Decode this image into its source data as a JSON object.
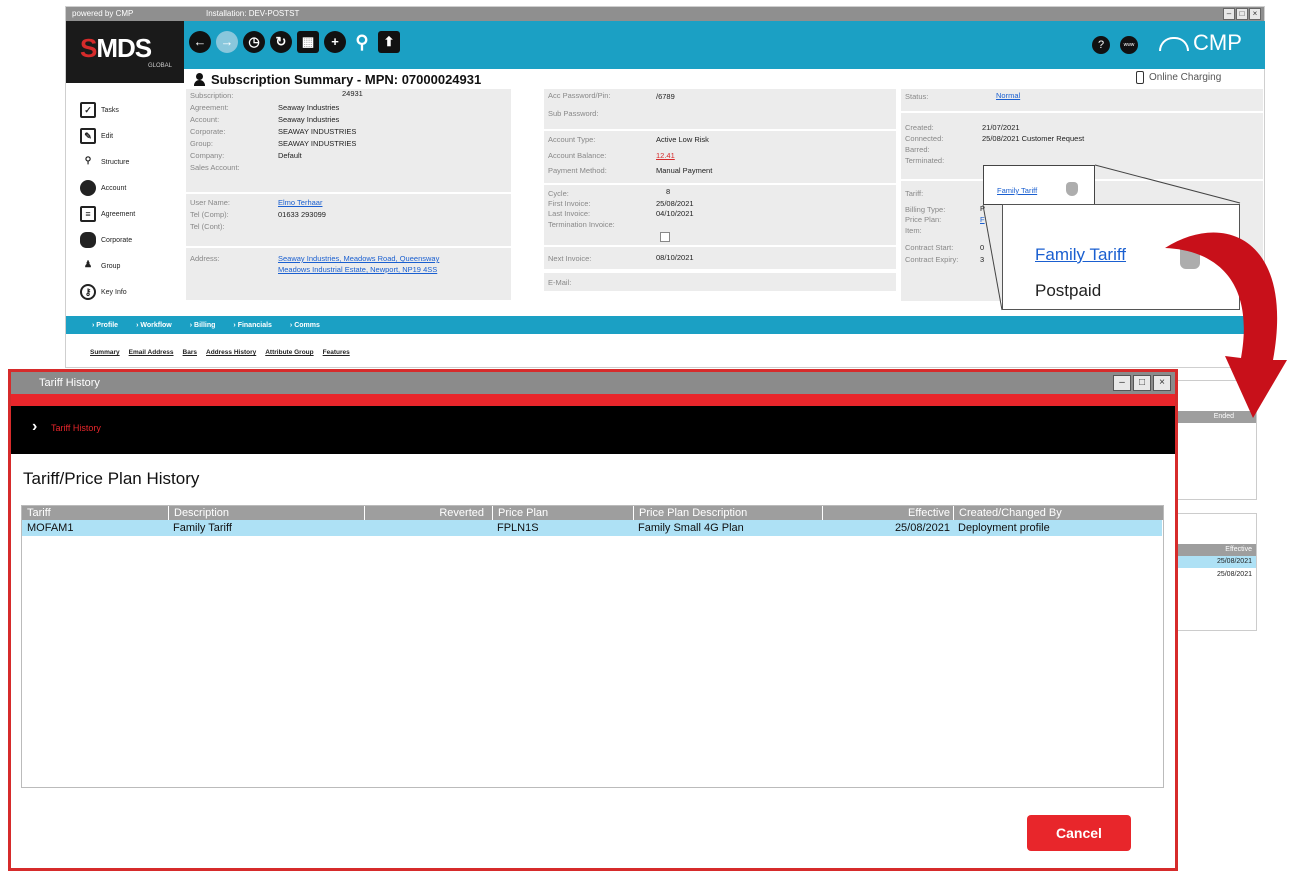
{
  "app": {
    "titlebar": {
      "powered": "powered by CMP",
      "installation": "Installation: DEV-POSTST"
    },
    "logo": {
      "name": "MDS",
      "sub": "GLOBAL"
    },
    "brand": "CMP",
    "summary_title": "Subscription Summary - MPN: 07000024931",
    "online_charging": "Online Charging",
    "sidebar": [
      {
        "label": "Tasks"
      },
      {
        "label": "Edit"
      },
      {
        "label": "Structure"
      },
      {
        "label": "Account"
      },
      {
        "label": "Agreement"
      },
      {
        "label": "Corporate"
      },
      {
        "label": "Group"
      },
      {
        "label": "Key Info"
      }
    ],
    "col1": {
      "subscription_l": "Subscription:",
      "subscription_v": "24931",
      "agreement_l": "Agreement:",
      "agreement_v": "Seaway Industries",
      "account_l": "Account:",
      "account_v": "Seaway Industries",
      "corporate_l": "Corporate:",
      "corporate_v": "SEAWAY INDUSTRIES",
      "group_l": "Group:",
      "group_v": "SEAWAY INDUSTRIES",
      "company_l": "Company:",
      "company_v": "Default",
      "sales_l": "Sales Account:",
      "user_l": "User Name:",
      "user_v": "Elmo Terhaar",
      "telcomp_l": "Tel (Comp):",
      "telcomp_v": "01633 293099",
      "telcont_l": "Tel (Cont):",
      "address_l": "Address:",
      "address_v1": "Seaway Industries, Meadows Road, Queensway",
      "address_v2": "Meadows Industrial Estate, Newport, NP19 4SS"
    },
    "col2": {
      "pwd_l": "Acc Password/Pin:",
      "pwd_v": "/6789",
      "subpwd_l": "Sub Password:",
      "acctype_l": "Account Type:",
      "acctype_v": "Active Low Risk",
      "balance_l": "Account Balance:",
      "balance_v": "12.41",
      "paym_l": "Payment Method:",
      "paym_v": "Manual Payment",
      "cycle_l": "Cycle:",
      "cycle_v": "8",
      "firstinv_l": "First Invoice:",
      "firstinv_v": "25/08/2021",
      "lastinv_l": "Last Invoice:",
      "lastinv_v": "04/10/2021",
      "terminv_l": "Termination Invoice:",
      "nextinv_l": "Next Invoice:",
      "nextinv_v": "08/10/2021",
      "email_l": "E-Mail:"
    },
    "col3": {
      "status_l": "Status:",
      "status_v": "Normal",
      "created_l": "Created:",
      "created_v": "21/07/2021",
      "connected_l": "Connected:",
      "connected_v": "25/08/2021 Customer Request",
      "barred_l": "Barred:",
      "terminated_l": "Terminated:",
      "tariff_l": "Tariff:",
      "tariff_v": "Family Tariff",
      "billing_l": "Billing Type:",
      "billing_v": "P",
      "priceplan_l": "Price Plan:",
      "priceplan_v": "F",
      "item_l": "Item:",
      "cstart_l": "Contract Start:",
      "cstart_v": "0",
      "cexpiry_l": "Contract Expiry:",
      "cexpiry_v": "3"
    },
    "callout": {
      "tariff": "Family Tariff",
      "billing": "Postpaid"
    },
    "navbar": [
      "Profile",
      "Workflow",
      "Billing",
      "Financials",
      "Comms"
    ],
    "subnav": [
      "Summary",
      "Email Address",
      "Bars",
      "Address History",
      "Attribute Group",
      "Features"
    ],
    "bg_panel1": {
      "header": "Ended"
    },
    "bg_panel2": {
      "header": "Effective",
      "rows": [
        "25/08/2021",
        "25/08/2021"
      ]
    }
  },
  "dialog": {
    "title": "Tariff History",
    "breadcrumb": "Tariff History",
    "heading": "Tariff/Price Plan History",
    "columns": [
      "Tariff",
      "Description",
      "Reverted",
      "Price Plan",
      "Price Plan Description",
      "Effective",
      "Created/Changed By"
    ],
    "rows": [
      [
        "MOFAM1",
        "Family Tariff",
        "",
        "FPLN1S",
        "Family Small 4G Plan",
        "25/08/2021",
        "Deployment profile"
      ]
    ],
    "cancel_label": "Cancel"
  },
  "colors": {
    "accent": "#1ba0c4",
    "brand_red": "#e8262b",
    "selected_row": "#aee1f5"
  }
}
